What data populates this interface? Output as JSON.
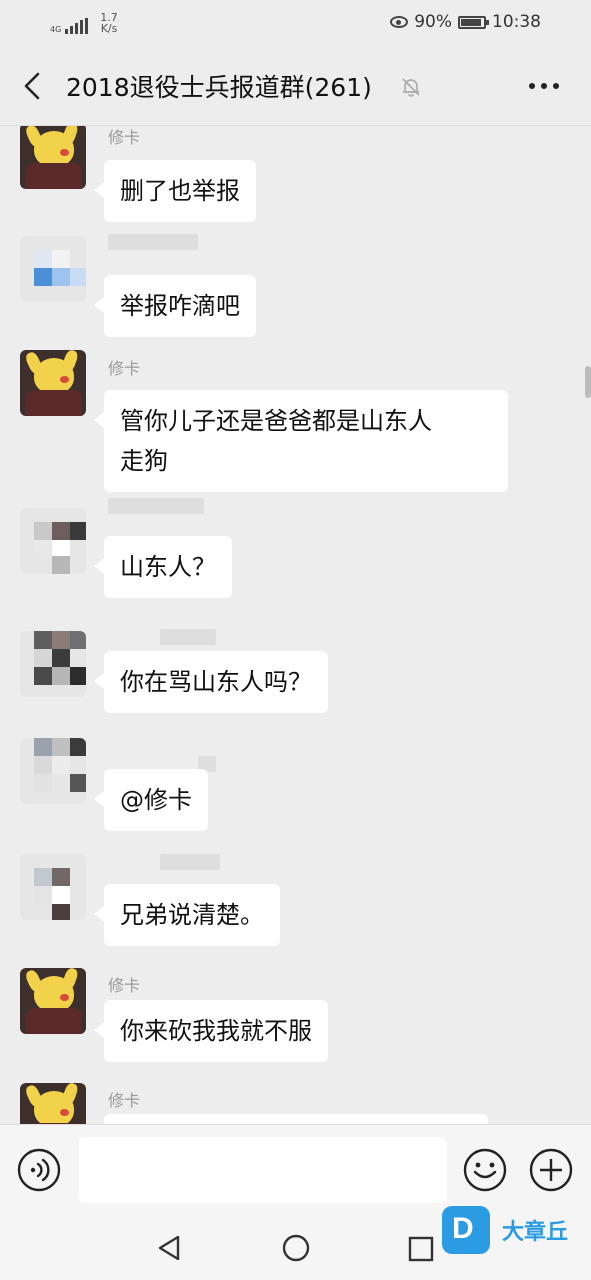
{
  "status_bar": {
    "network": "4G",
    "speed_value": "1.7",
    "speed_unit": "K/s",
    "battery": "90%",
    "time": "10:38"
  },
  "header": {
    "title": "2018退役士兵报道群(261)",
    "back_icon": "chevron-left-icon",
    "mute_icon": "bell-off-icon",
    "more_icon": "more-dots-icon"
  },
  "messages": [
    {
      "sender": "修卡",
      "text": "删了也举报",
      "avatar": "pikachu"
    },
    {
      "sender": "",
      "text": "举报咋滴吧",
      "avatar": "blurred"
    },
    {
      "sender": "修卡",
      "text": "管你儿子还是爸爸都是山东人\n走狗",
      "avatar": "pikachu"
    },
    {
      "sender": "",
      "text": "山东人？",
      "avatar": "blurred"
    },
    {
      "sender": "",
      "text": "你在骂山东人吗？",
      "avatar": "blurred"
    },
    {
      "sender": "",
      "text": "@修卡",
      "avatar": "blurred"
    },
    {
      "sender": "",
      "text": "兄弟说清楚。",
      "avatar": "blurred"
    },
    {
      "sender": "修卡",
      "text": "你来砍我我就不服",
      "avatar": "pikachu"
    },
    {
      "sender": "修卡",
      "text": "",
      "avatar": "pikachu"
    }
  ],
  "input_bar": {
    "voice_icon": "voice-icon",
    "input_value": "",
    "emoji_icon": "emoji-icon",
    "plus_icon": "plus-icon"
  },
  "nav_bar": {
    "back": "nav-back-icon",
    "home": "nav-home-icon",
    "recent": "nav-recent-icon"
  },
  "watermark": {
    "logo_letter": "D",
    "text": "大章丘"
  },
  "colors": {
    "background": "#ededed",
    "bubble": "#ffffff",
    "sender_name": "#999999",
    "watermark": "#2b9be3"
  }
}
